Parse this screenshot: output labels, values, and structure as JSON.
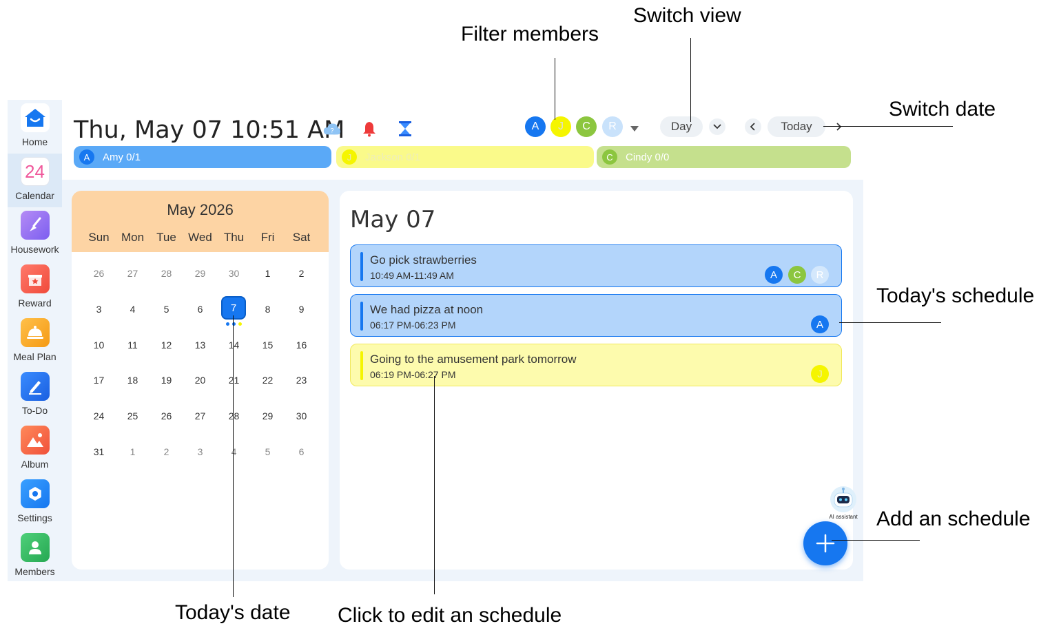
{
  "annotations": {
    "filter_members": "Filter members",
    "switch_view": "Switch view",
    "switch_date": "Switch date",
    "todays_schedule": "Today's schedule",
    "add_schedule": "Add an schedule",
    "todays_date": "Today's date",
    "click_edit": "Click to edit an schedule"
  },
  "sidebar": {
    "items": [
      {
        "label": "Home",
        "icon": "home-icon"
      },
      {
        "label": "Calendar",
        "icon": "calendar-icon",
        "icon_text": "24"
      },
      {
        "label": "Housework",
        "icon": "broom-icon"
      },
      {
        "label": "Reward",
        "icon": "gift-icon"
      },
      {
        "label": "Meal Plan",
        "icon": "cloche-icon"
      },
      {
        "label": "To-Do",
        "icon": "pen-icon"
      },
      {
        "label": "Album",
        "icon": "picture-icon"
      },
      {
        "label": "Settings",
        "icon": "gear-icon"
      },
      {
        "label": "Members",
        "icon": "person-icon"
      }
    ]
  },
  "header": {
    "datetime": "Thu, May 07 10:51 AM",
    "cloud_icon_text": "?",
    "filter_avatars": [
      "A",
      "J",
      "C",
      "R"
    ],
    "view_label": "Day",
    "today_label": "Today"
  },
  "members": [
    {
      "initial": "A",
      "text": "Amy  0/1",
      "color": "#5aa9f7"
    },
    {
      "initial": "J",
      "text": "Jackson  0/1",
      "color": "#fafa8a"
    },
    {
      "initial": "C",
      "text": "Cindy  0/0",
      "color": "#c5e08d"
    }
  ],
  "calendar": {
    "title": "May 2026",
    "weekdays": [
      "Sun",
      "Mon",
      "Tue",
      "Wed",
      "Thu",
      "Fri",
      "Sat"
    ],
    "weeks": [
      [
        "26",
        "27",
        "28",
        "29",
        "30",
        "1",
        "2"
      ],
      [
        "3",
        "4",
        "5",
        "6",
        "7",
        "8",
        "9"
      ],
      [
        "10",
        "11",
        "12",
        "13",
        "14",
        "15",
        "16"
      ],
      [
        "17",
        "18",
        "19",
        "20",
        "21",
        "22",
        "23"
      ],
      [
        "24",
        "25",
        "26",
        "27",
        "28",
        "29",
        "30"
      ],
      [
        "31",
        "1",
        "2",
        "3",
        "4",
        "5",
        "6"
      ]
    ],
    "today": "7"
  },
  "day_panel": {
    "title": "May 07",
    "events": [
      {
        "title": "Go pick strawberries",
        "time": "10:49 AM-11:49 AM",
        "avatars": [
          "A",
          "C",
          "R"
        ]
      },
      {
        "title": "We had pizza at noon",
        "time": "06:17 PM-06:23 PM",
        "avatars": [
          "A"
        ]
      },
      {
        "title": "Going to the amusement park tomorrow",
        "time": "06:19 PM-06:27 PM",
        "avatars": [
          "J"
        ]
      }
    ]
  },
  "ai_assistant": {
    "label": "AI assistant"
  },
  "colors": {
    "accent": "#1677f0",
    "amy": "#1677f0",
    "jackson": "#f5f500",
    "cindy": "#8cc63f",
    "r_member": "#c9e2fb",
    "calendar_header": "#fdd4a4",
    "event_blue": "#b3d5fb",
    "event_yellow": "#fdfbad"
  }
}
